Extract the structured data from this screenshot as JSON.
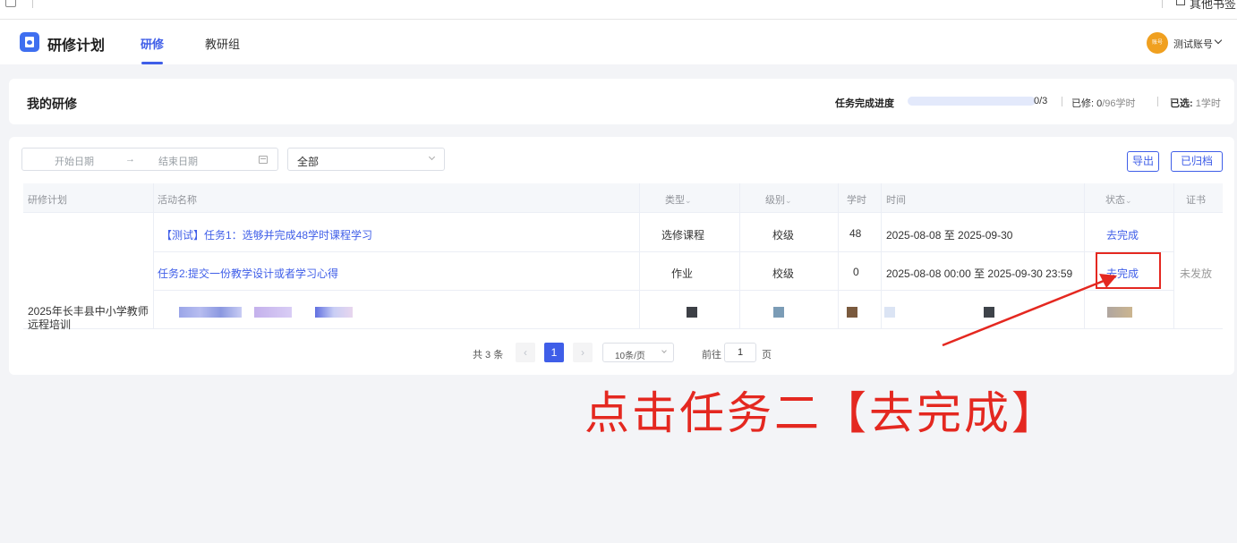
{
  "bookmarks": {
    "other_label": "其他书签"
  },
  "header": {
    "app_title": "研修计划",
    "tabs": [
      {
        "label": "研修",
        "active": true
      },
      {
        "label": "教研组",
        "active": false
      }
    ],
    "avatar_text": "账号",
    "user_name": "测试账号"
  },
  "progress": {
    "title": "我的研修",
    "label": "任务完成进度",
    "completed": 0,
    "total": 3,
    "count_text": "0/3",
    "studied_label": "已修:",
    "studied_value": "0",
    "studied_total": "/96学时",
    "selected_label": "已选:",
    "selected_value": "1学时"
  },
  "filters": {
    "start_placeholder": "开始日期",
    "separator": "→",
    "end_placeholder": "结束日期",
    "select_value": "全部",
    "export_label": "导出",
    "archived_label": "已归档"
  },
  "table": {
    "columns": {
      "plan": "研修计划",
      "activity": "活动名称",
      "type": "类型",
      "level": "级别",
      "hours": "学时",
      "time": "时间",
      "status": "状态",
      "certificate": "证书"
    },
    "plan_name": "2025年长丰县中小学教师远程培训",
    "certificate_status": "未发放",
    "rows": [
      {
        "activity": "【测试】任务1：选够并完成48学时课程学习",
        "type": "选修课程",
        "level": "校级",
        "hours": "48",
        "time": "2025-08-08 至 2025-09-30",
        "status": "去完成"
      },
      {
        "activity": "任务2:提交一份教学设计或者学习心得",
        "type": "作业",
        "level": "校级",
        "hours": "0",
        "time": "2025-08-08 00:00 至 2025-09-30 23:59",
        "status": "去完成"
      }
    ]
  },
  "pagination": {
    "total_text": "共 3 条",
    "current_page": "1",
    "page_size": "10条/页",
    "jump_label": "前往",
    "jump_value": "1",
    "page_suffix": "页"
  },
  "annotation": {
    "text": "点击任务二【去完成】",
    "color": "#e42820"
  },
  "colors": {
    "accent": "#3f5ee8",
    "annotation": "#e42820",
    "avatar": "#f0a020"
  }
}
